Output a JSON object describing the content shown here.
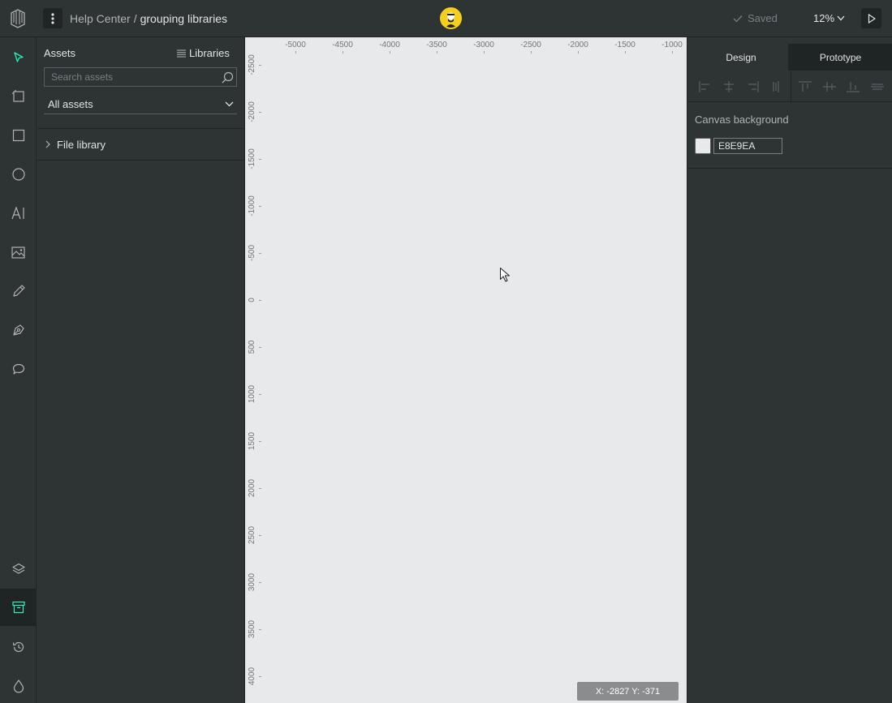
{
  "header": {
    "project": "Help Center",
    "separator": "/",
    "file_name": "grouping libraries",
    "saved_label": "Saved",
    "zoom_label": "12%"
  },
  "assets_panel": {
    "title": "Assets",
    "libraries_label": "Libraries",
    "search_placeholder": "Search assets",
    "filter_value": "All assets",
    "file_library_label": "File library"
  },
  "canvas": {
    "ruler_x_ticks": [
      "-5000",
      "-4500",
      "-4000",
      "-3500",
      "-3000",
      "-2500",
      "-2000",
      "-1500",
      "-1000"
    ],
    "ruler_y_ticks": [
      "-2500",
      "-2000",
      "-1500",
      "-1000",
      "-500",
      "0",
      "500",
      "1000",
      "1500",
      "2000",
      "2500",
      "3000",
      "3500",
      "4000"
    ],
    "coords_label": "X: -2827 Y: -371",
    "background": "#e8e9ea"
  },
  "design_panel": {
    "tab_design": "Design",
    "tab_prototype": "Prototype",
    "canvas_background_title": "Canvas background",
    "canvas_background_hex": "E8E9EA"
  },
  "colors": {
    "accent": "#31efb8",
    "panel": "#2e3434",
    "panel_dark": "#1f2424"
  },
  "toolbar_icons": [
    "move-tool-icon",
    "board-tool-icon",
    "rectangle-tool-icon",
    "ellipse-tool-icon",
    "text-tool-icon",
    "image-tool-icon",
    "curve-tool-icon",
    "path-tool-icon",
    "comments-tool-icon",
    "layers-icon",
    "assets-icon",
    "history-icon",
    "color-palette-icon"
  ]
}
